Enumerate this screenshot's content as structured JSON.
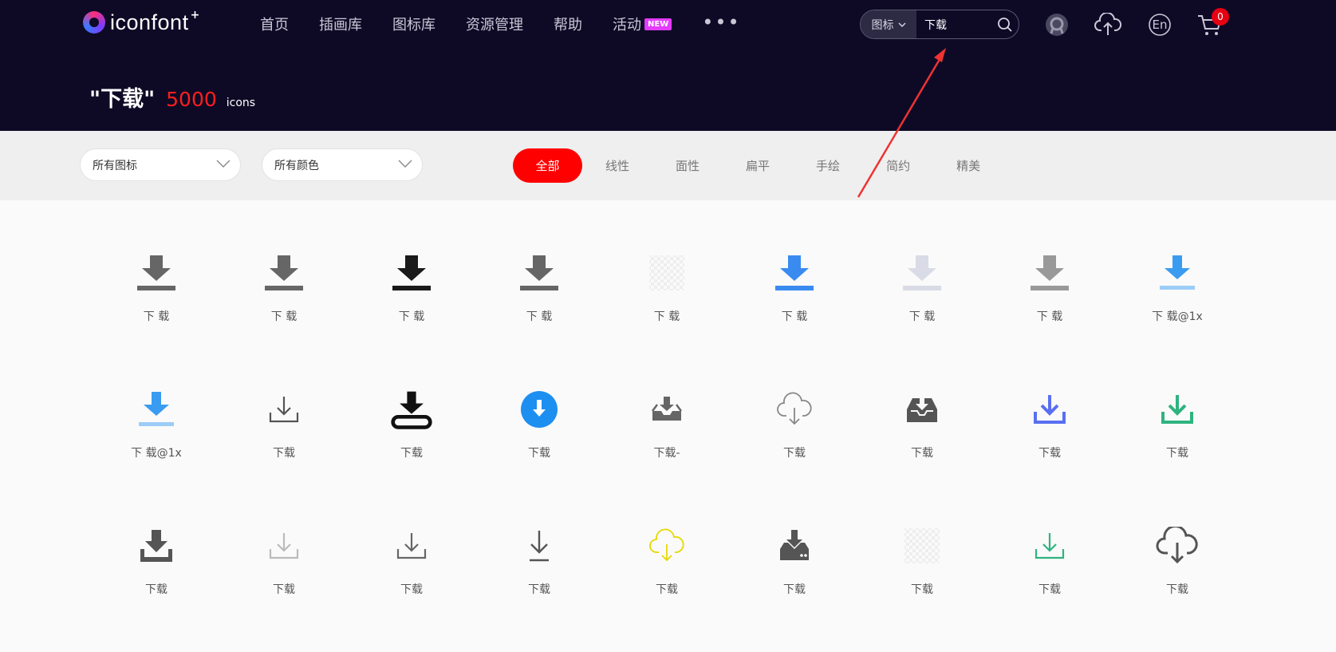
{
  "logo": {
    "text": "iconfont",
    "plus": "+"
  },
  "nav": {
    "items": [
      "首页",
      "插画库",
      "图标库",
      "资源管理",
      "帮助",
      "活动"
    ],
    "new_badge": "NEW",
    "more": "•••"
  },
  "search": {
    "type": "图标",
    "value": "下载"
  },
  "header_icons": [
    "user-avatar-icon",
    "upload-cloud-icon",
    "language-en-icon",
    "cart-icon"
  ],
  "language_label": "En",
  "cart_count": "0",
  "results": {
    "query": "\"下载\"",
    "count": "5000",
    "unit": "icons"
  },
  "filters": {
    "type_dropdown": "所有图标",
    "color_dropdown": "所有颜色",
    "tabs": [
      "全部",
      "线性",
      "面性",
      "扁平",
      "手绘",
      "简约",
      "精美"
    ],
    "active_tab": "全部"
  },
  "colors": {
    "header_bg": "#0e0a26",
    "accent": "#ff0000",
    "count": "#ff1e1e"
  },
  "icons": [
    {
      "label": "下 载",
      "style": "bar-arrow",
      "color": "#666666"
    },
    {
      "label": "下 载",
      "style": "bar-arrow",
      "color": "#666666"
    },
    {
      "label": "下 载",
      "style": "bar-arrow",
      "color": "#1a1a1a"
    },
    {
      "label": "下 载",
      "style": "bar-arrow",
      "color": "#666666"
    },
    {
      "label": "下 载",
      "style": "transparent",
      "color": "#e8e8e8"
    },
    {
      "label": "下 载",
      "style": "bar-arrow",
      "color": "#3a8bf0"
    },
    {
      "label": "下 载",
      "style": "bar-arrow",
      "color": "#d9dbe6"
    },
    {
      "label": "下 载",
      "style": "bar-arrow",
      "color": "#999999"
    },
    {
      "label": "下 载@1x",
      "style": "bar-arrow-light",
      "color": "#3a9cf0"
    },
    {
      "label": "下 载@1x",
      "style": "bar-arrow-light",
      "color": "#3a9cf0"
    },
    {
      "label": "下载",
      "style": "tray-line",
      "color": "#555555"
    },
    {
      "label": "下载",
      "style": "tray-pill",
      "color": "#111111"
    },
    {
      "label": "下载",
      "style": "circle",
      "color": "#1d8ff0"
    },
    {
      "label": "下载-",
      "style": "inbox",
      "color": "#666666"
    },
    {
      "label": "下载",
      "style": "cloud-line",
      "color": "#888888"
    },
    {
      "label": "下载",
      "style": "inbox-fill",
      "color": "#555555"
    },
    {
      "label": "下载",
      "style": "tray-bold",
      "color": "#5a6ff0"
    },
    {
      "label": "下载",
      "style": "tray-bold",
      "color": "#2fb37f"
    },
    {
      "label": "下载",
      "style": "tray-fill",
      "color": "#555555"
    },
    {
      "label": "下载",
      "style": "tray-line",
      "color": "#bbbbbb"
    },
    {
      "label": "下载",
      "style": "tray-line",
      "color": "#666666"
    },
    {
      "label": "下载",
      "style": "arrow-line",
      "color": "#555555"
    },
    {
      "label": "下载",
      "style": "cloud-line",
      "color": "#e6d800"
    },
    {
      "label": "下载",
      "style": "drive",
      "color": "#555555"
    },
    {
      "label": "下载",
      "style": "transparent",
      "color": "#e8e8e8"
    },
    {
      "label": "下载",
      "style": "tray-line",
      "color": "#2fb37f"
    },
    {
      "label": "下载",
      "style": "cloud-bold",
      "color": "#555555"
    }
  ]
}
